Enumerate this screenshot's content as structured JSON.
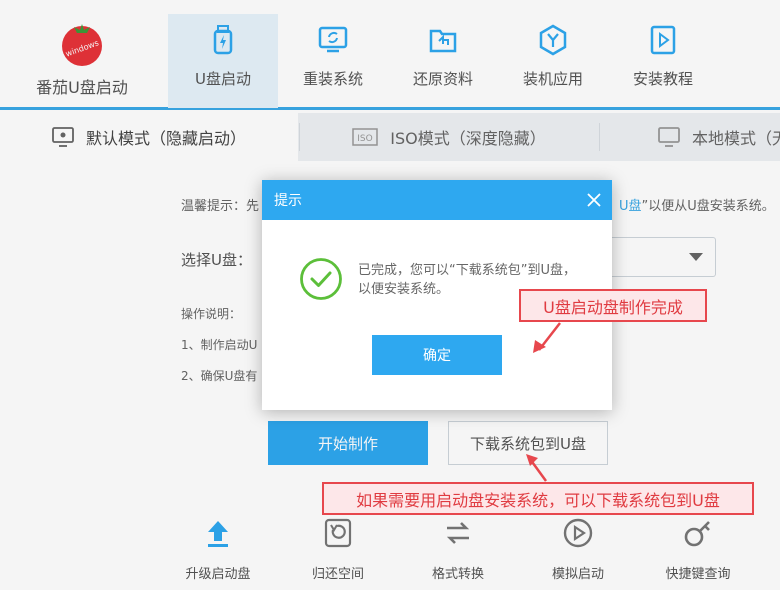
{
  "app": {
    "title": "番茄U盘启动"
  },
  "nav": {
    "items": [
      {
        "label": "U盘启动",
        "icon": "usb-bolt-icon",
        "active": true
      },
      {
        "label": "重装系统",
        "icon": "monitor-refresh-icon",
        "active": false
      },
      {
        "label": "还原资料",
        "icon": "folder-restore-icon",
        "active": false
      },
      {
        "label": "装机应用",
        "icon": "hexagon-y-icon",
        "active": false
      },
      {
        "label": "安装教程",
        "icon": "play-book-icon",
        "active": false
      }
    ]
  },
  "modes": [
    {
      "label": "默认模式（隐藏启动）",
      "icon": "monitor-icon",
      "active": true
    },
    {
      "label": "ISO模式（深度隐藏）",
      "icon": "iso-icon",
      "active": false
    },
    {
      "label": "本地模式（无",
      "icon": "monitor-icon",
      "active": false
    }
  ],
  "main": {
    "tip_prefix": "温馨提示：先",
    "tip_accent": "U盘",
    "tip_suffix": "”以便从U盘安装系统。",
    "udisk_label": "选择U盘：",
    "op_title": "操作说明：",
    "op_line_1": "1、制作启动U",
    "op_line_2": "2、确保U盘有",
    "start_button": "开始制作",
    "download_button": "下载系统包到U盘"
  },
  "tools": [
    {
      "label": "升级启动盘",
      "icon": "upload-arrow-icon"
    },
    {
      "label": "归还空间",
      "icon": "restore-disk-icon"
    },
    {
      "label": "格式转换",
      "icon": "swap-arrows-icon"
    },
    {
      "label": "模拟启动",
      "icon": "play-circle-icon"
    },
    {
      "label": "快捷键查询",
      "icon": "key-search-icon"
    }
  ],
  "dialog": {
    "title": "提示",
    "message": "已完成，您可以“下载系统包”到U盘，以便安装系统。",
    "ok_button": "确定"
  },
  "annotations": {
    "callout_top": "U盘启动盘制作完成",
    "callout_bottom": "如果需要用启动盘安装系统，可以下载系统包到U盘"
  },
  "colors": {
    "accent": "#2ea8f0",
    "header_border": "#3aa9e8",
    "callout_red": "#e7474d",
    "callout_bg": "#fde7e9",
    "check_green": "#5cbf3a",
    "logo_red": "#e8333a"
  }
}
